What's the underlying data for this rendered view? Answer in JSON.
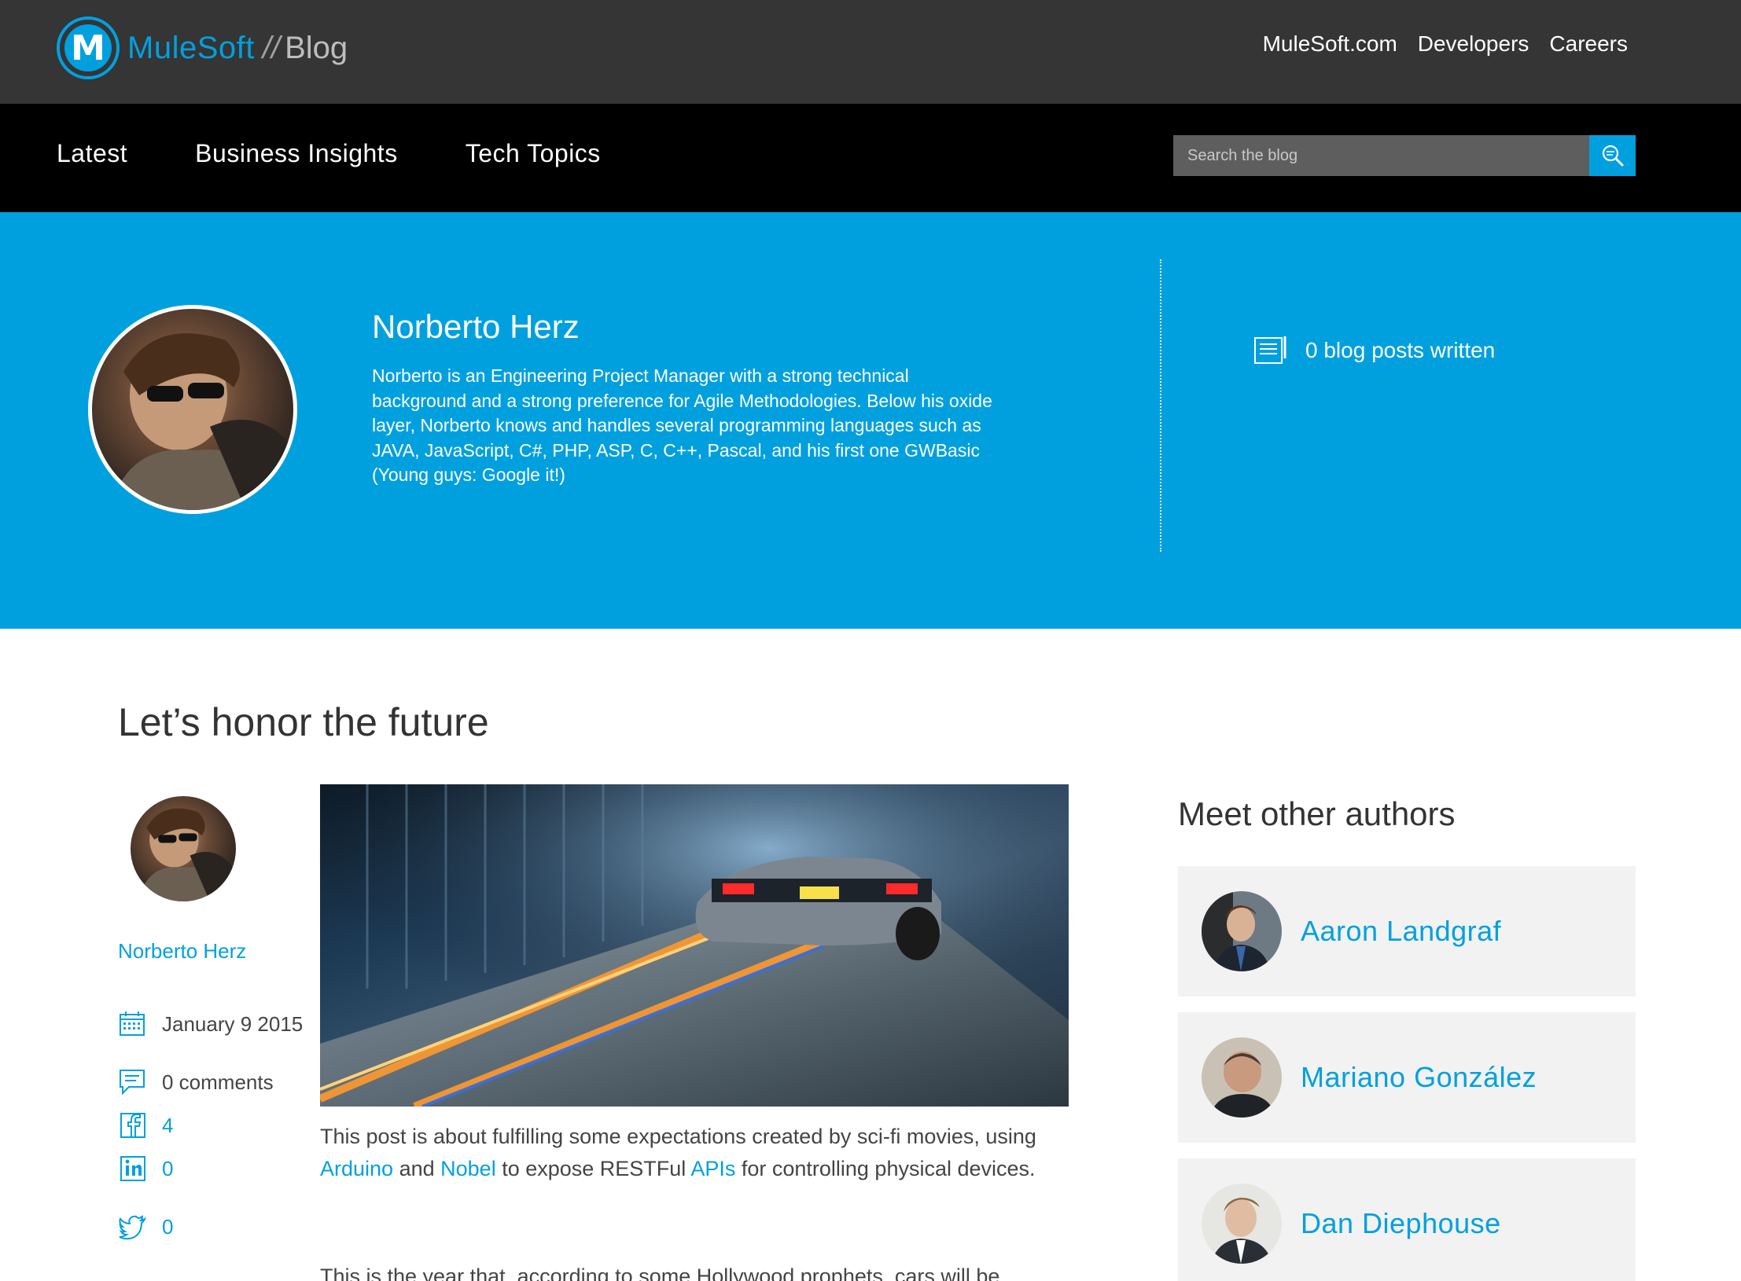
{
  "header": {
    "brand": "MuleSoft",
    "separator": "//",
    "section": "Blog",
    "links": [
      "MuleSoft.com",
      "Developers",
      "Careers"
    ]
  },
  "nav": {
    "items": [
      "Latest",
      "Business Insights",
      "Tech Topics"
    ],
    "search_placeholder": "Search the blog"
  },
  "author_hero": {
    "name": "Norberto Herz",
    "bio": "Norberto is an Engineering Project Manager with a strong technical background and a strong preference for Agile Methodologies. Below his oxide layer, Norberto knows and handles several programming languages such as JAVA, JavaScript, C#, PHP, ASP, C, C++, Pascal, and his first one GWBasic (Young guys: Google it!)",
    "posts_written": "0 blog posts written"
  },
  "article": {
    "title": "Let’s honor the future",
    "author": "Norberto Herz",
    "date": "January 9 2015",
    "comments": "0 comments",
    "facebook_count": "4",
    "linkedin_count": "0",
    "twitter_count": "0",
    "body_p1_a": "This post is about fulfilling some expectations created by sci-fi movies, using ",
    "link_arduino": "Arduino",
    "body_p1_b": " and ",
    "link_nobel": "Nobel",
    "body_p1_c": " to expose RESTFul ",
    "link_apis": "APIs",
    "body_p1_d": " for controlling physical devices.",
    "body_p2": "This is the year that, according to some Hollywood prophets, cars will be"
  },
  "sidebar": {
    "title": "Meet other authors",
    "authors": [
      "Aaron Landgraf",
      "Mariano González",
      "Dan Diephouse"
    ]
  },
  "colors": {
    "accent": "#00a0df",
    "header_bg": "#353535",
    "nav_bg": "#000000",
    "card_bg": "#f2f2f2"
  },
  "icons": [
    "search-icon",
    "document-icon",
    "calendar-icon",
    "comment-icon",
    "facebook-icon",
    "linkedin-icon",
    "twitter-icon"
  ]
}
